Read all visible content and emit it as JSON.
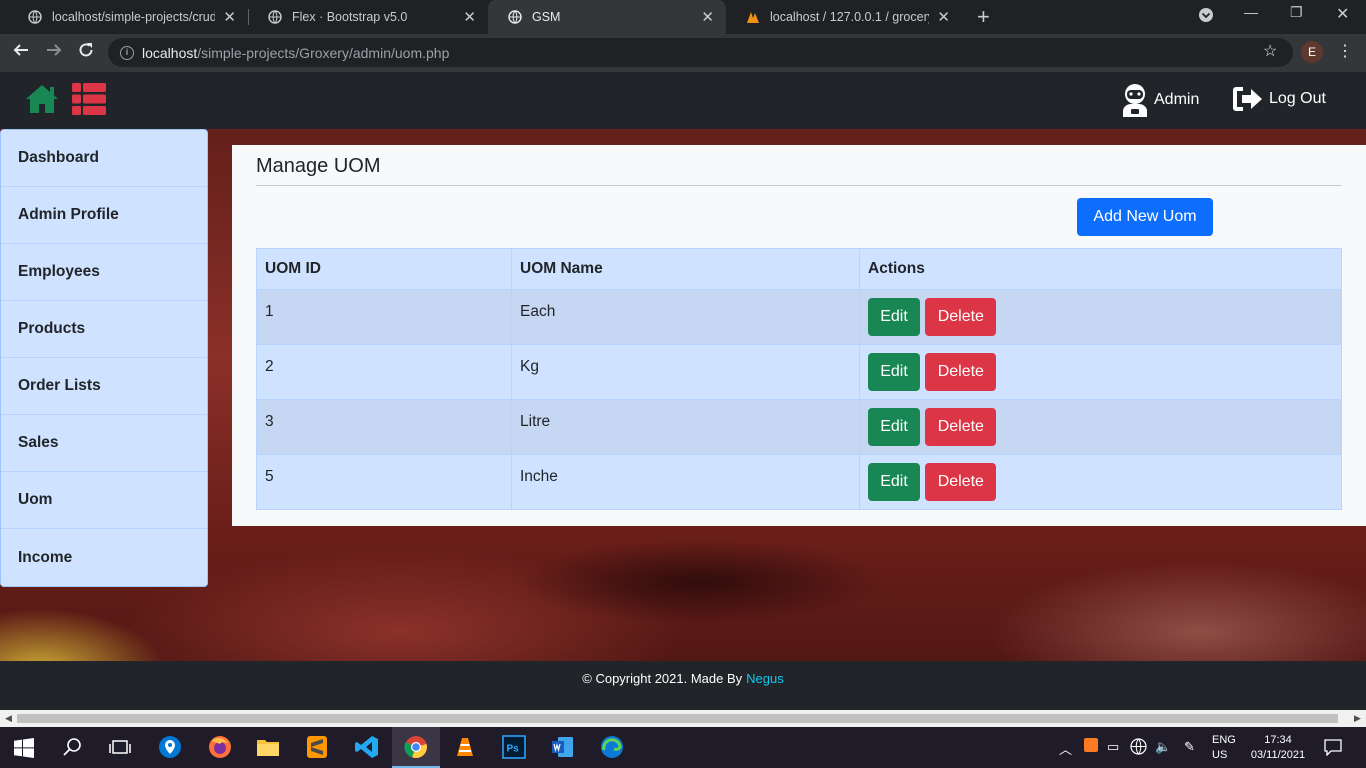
{
  "browser": {
    "tabs": [
      {
        "title": "localhost/simple-projects/crud-u",
        "active": false
      },
      {
        "title": "Flex · Bootstrap v5.0",
        "active": false
      },
      {
        "title": "GSM",
        "active": true
      },
      {
        "title": "localhost / 127.0.0.1 / grocery / s",
        "active": false
      }
    ],
    "url_host": "localhost",
    "url_path": "/simple-projects/Groxery/admin/uom.php",
    "profile_initial": "E"
  },
  "topnav": {
    "admin_label": "Admin",
    "logout_label": "Log Out"
  },
  "sidebar": {
    "items": [
      {
        "label": "Dashboard"
      },
      {
        "label": "Admin Profile"
      },
      {
        "label": "Employees"
      },
      {
        "label": "Products"
      },
      {
        "label": "Order Lists"
      },
      {
        "label": "Sales"
      },
      {
        "label": "Uom"
      },
      {
        "label": "Income"
      }
    ]
  },
  "main": {
    "title": "Manage UOM",
    "add_button": "Add New Uom",
    "table": {
      "headers": [
        "UOM ID",
        "UOM Name",
        "Actions"
      ],
      "rows": [
        {
          "id": "1",
          "name": "Each"
        },
        {
          "id": "2",
          "name": "Kg"
        },
        {
          "id": "3",
          "name": "Litre"
        },
        {
          "id": "5",
          "name": "Inche"
        }
      ],
      "edit_label": "Edit",
      "delete_label": "Delete"
    }
  },
  "footer": {
    "text": "© Copyright 2021. Made By",
    "author": "Negus"
  },
  "taskbar": {
    "lang_1": "ENG",
    "lang_2": "US",
    "time": "17:34",
    "date": "03/11/2021"
  },
  "colors": {
    "primary": "#0d6efd",
    "success": "#198754",
    "danger": "#dc3545",
    "sidebar_bg": "#cfe2ff",
    "navbar_bg": "#212529"
  }
}
